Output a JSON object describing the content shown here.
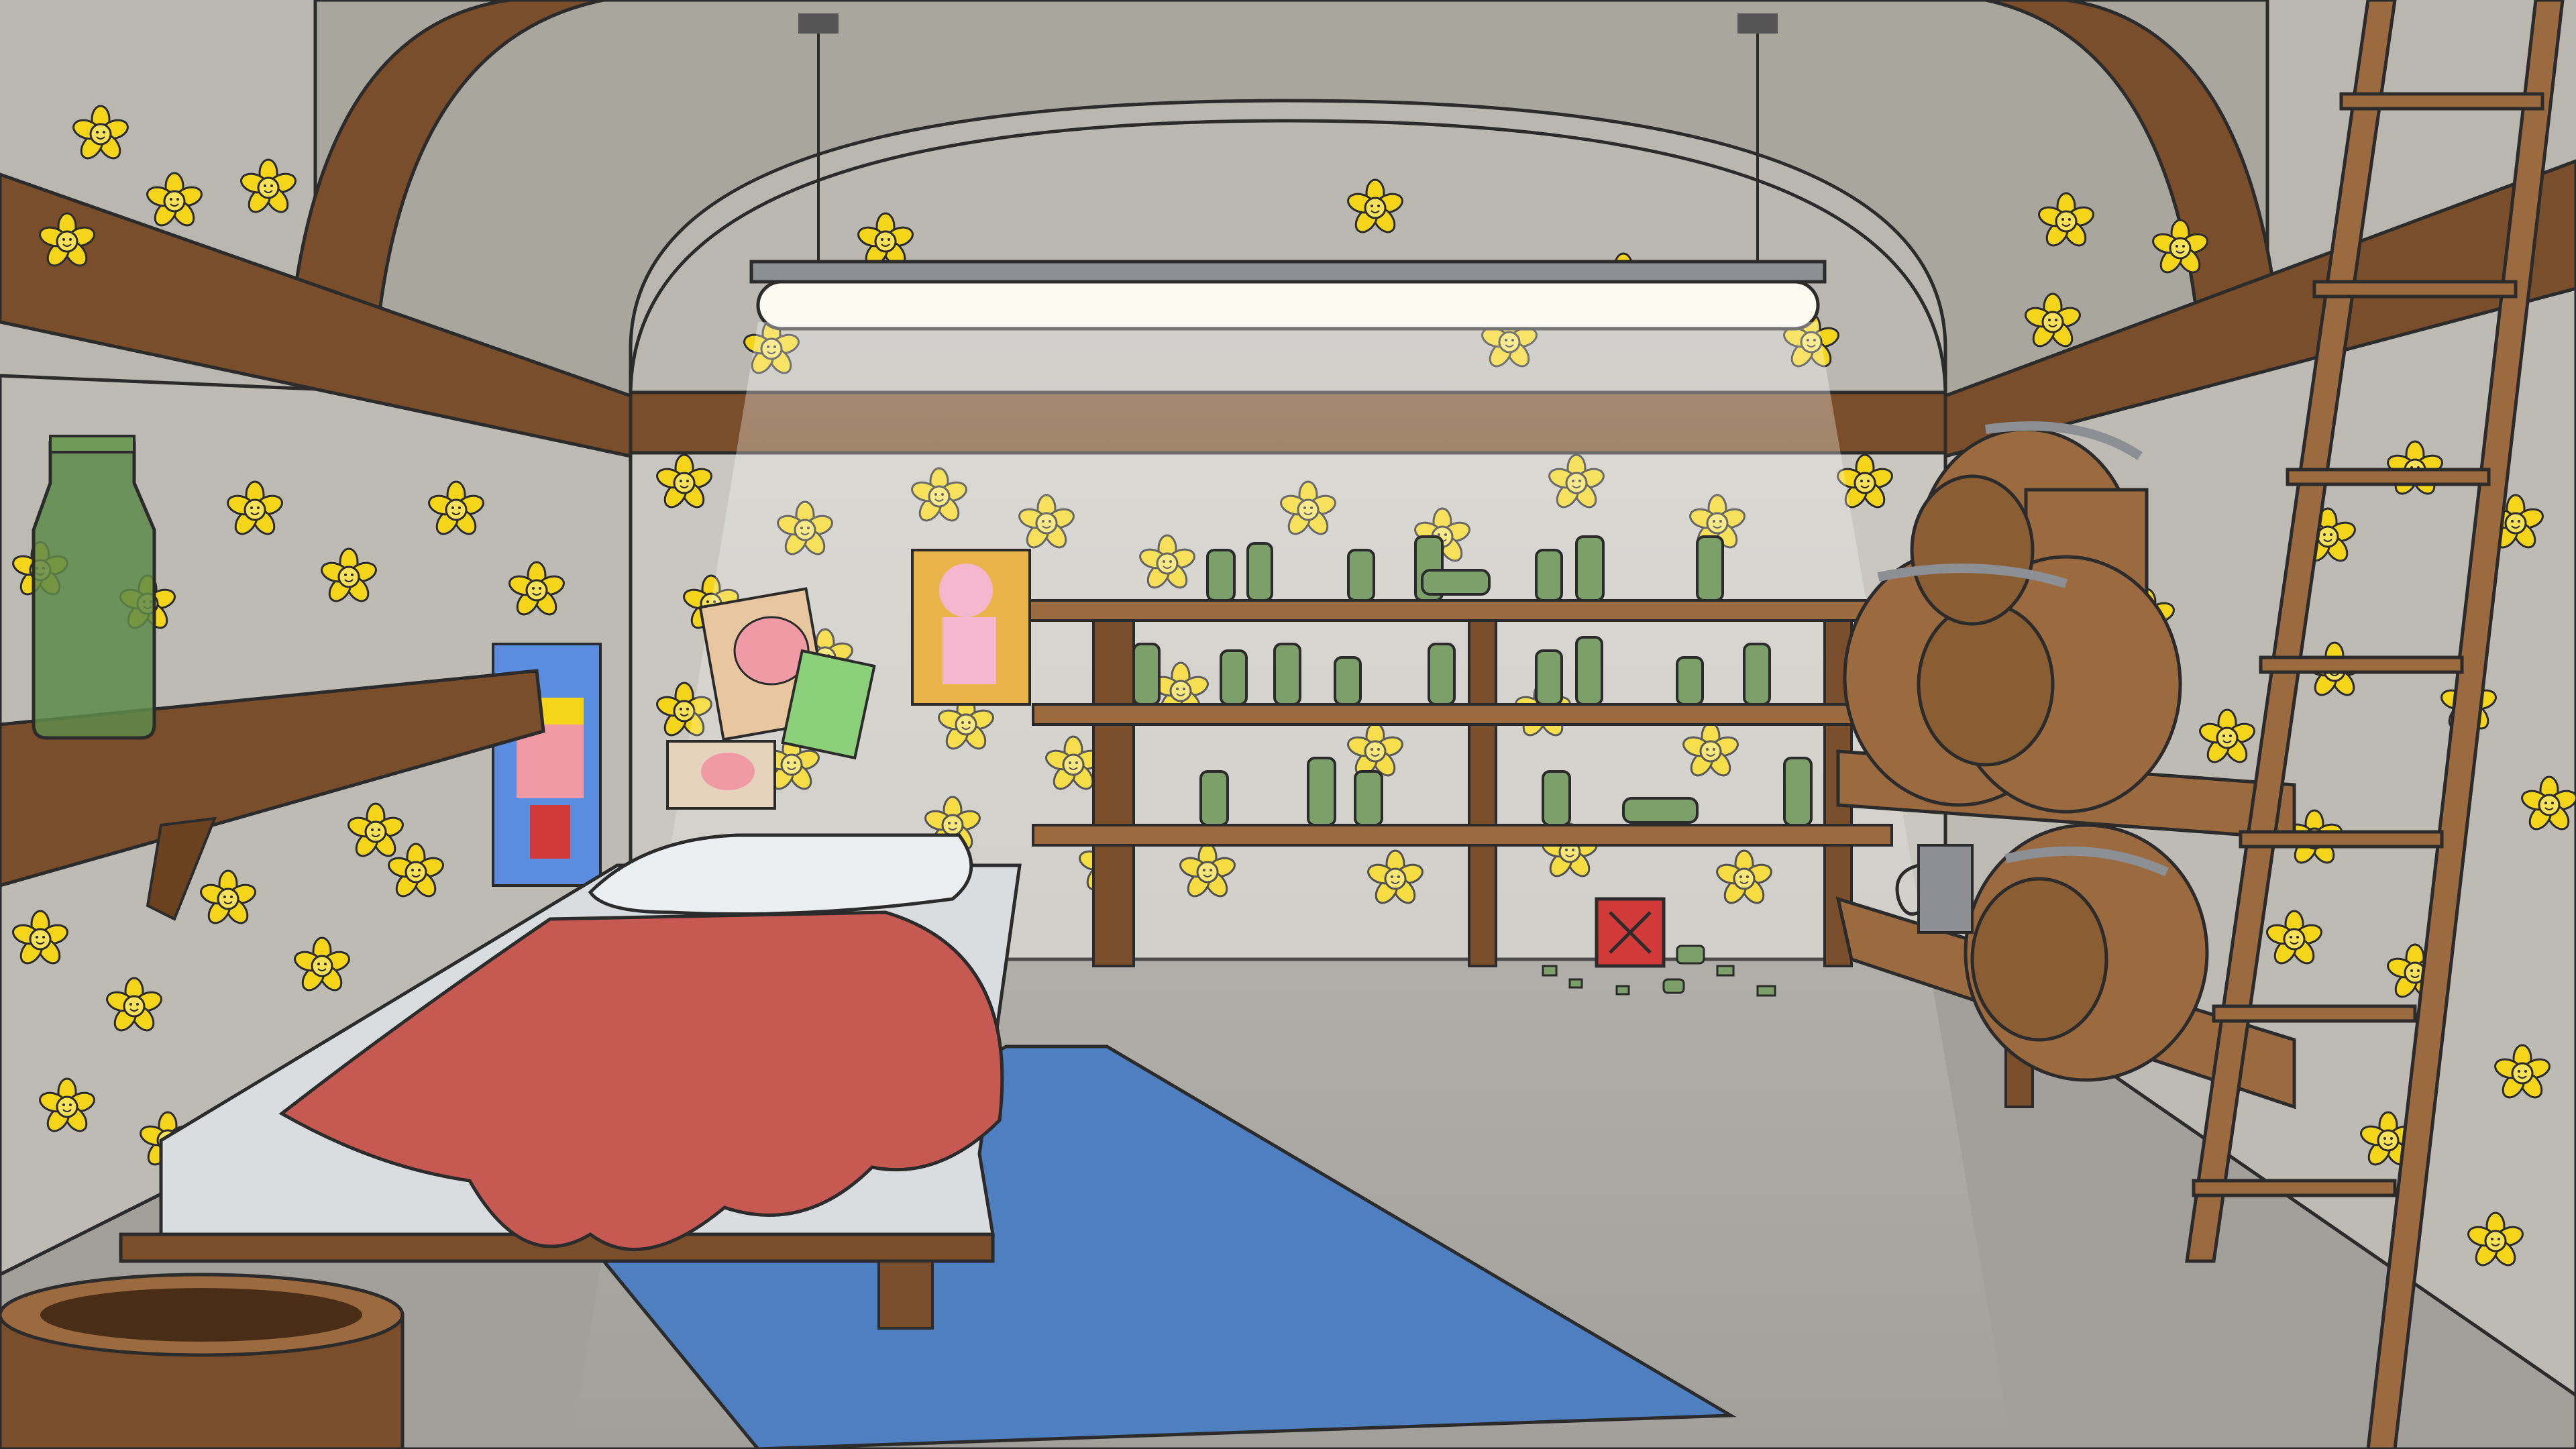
{
  "scene": {
    "name": "cellar-bedroom",
    "palette": {
      "wall": "#c9c7c0",
      "wall_dark": "#a9a69e",
      "floor": "#a2a09a",
      "wood": "#7a4e2a",
      "wood_light": "#9b6a3f",
      "flower": "#f4d51a",
      "flower_center": "#f7e25a",
      "outline": "#2b2b2b",
      "blanket": "#c65a52",
      "rug": "#4e7fc0",
      "mattress": "#d9dde0",
      "light": "#fbfaf0",
      "bottle": "#7da06a",
      "metal": "#8c8f93",
      "gas_can": "#d23a3a"
    },
    "objects": [
      "ceiling-lamp",
      "arched-ceiling-beam",
      "left-upper-shelf",
      "left-wall-shelf",
      "green-bottle",
      "bottle-shelf",
      "bed",
      "pillow",
      "blanket",
      "rug",
      "wine-barrels",
      "barrel-rack",
      "ladder",
      "metal-mug",
      "gas-can",
      "broken-glass",
      "posters",
      "open-barrel"
    ],
    "posters": [
      "pig-king-poster",
      "pig-portrait-poster",
      "pig-family-poster",
      "pig-photo-poster",
      "pink-pig-painting"
    ]
  }
}
